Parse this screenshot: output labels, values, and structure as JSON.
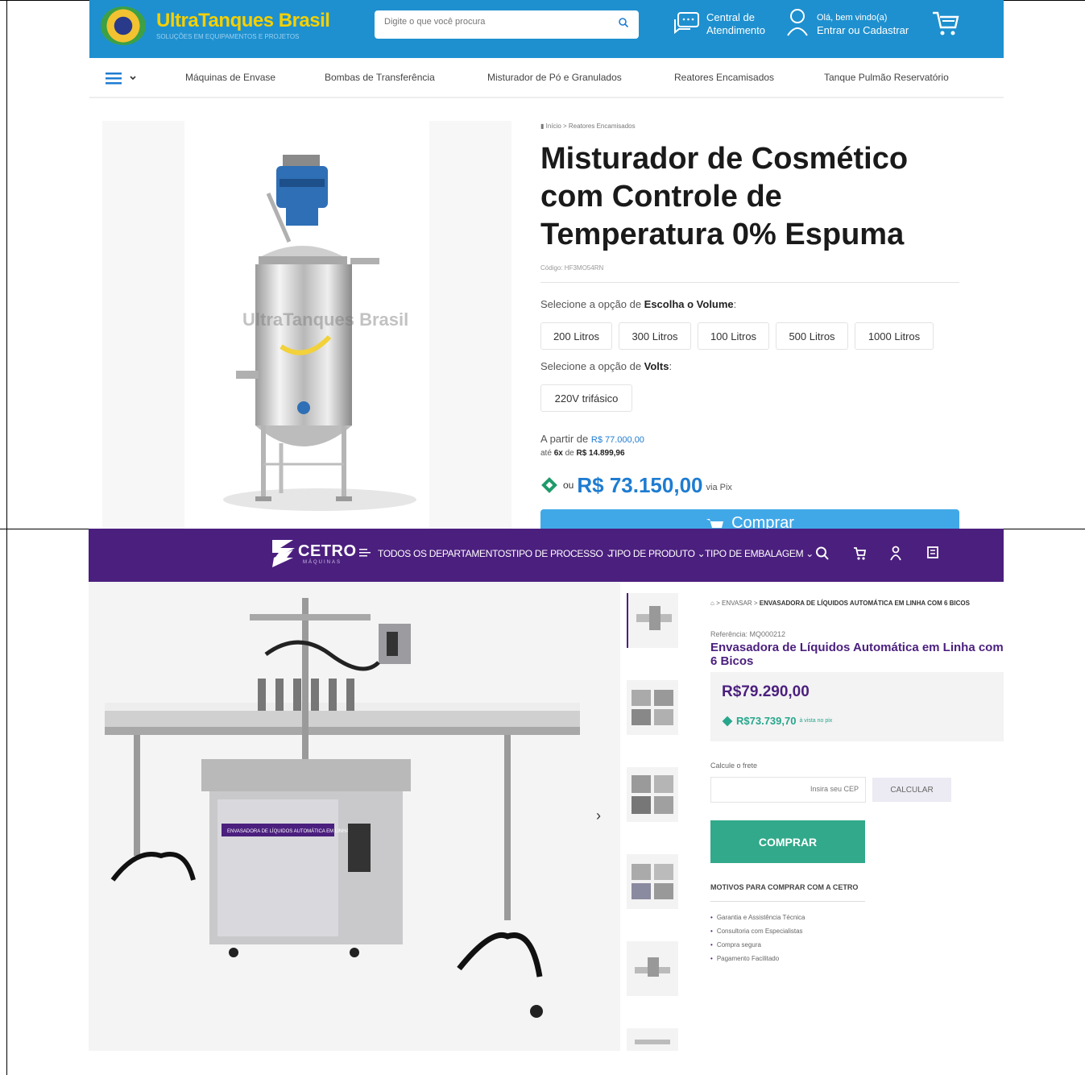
{
  "panel1": {
    "logo": {
      "name": "UltraTanques Brasil",
      "tagline": "SOLUÇÕES EM EQUIPAMENTOS E PROJETOS"
    },
    "search": {
      "placeholder": "Digite o que você procura"
    },
    "support": {
      "line1": "Central de",
      "line2": "Atendimento"
    },
    "account": {
      "line1": "Olá, bem vindo(a)",
      "line2": "Entrar ou Cadastrar"
    },
    "nav": [
      "Máquinas de Envase",
      "Bombas de Transferência",
      "Misturador de Pó e Granulados",
      "Reatores Encamisados",
      "Tanque Pulmão Reservatório"
    ],
    "breadcrumb": {
      "home": "Início",
      "sep": ">",
      "current": "Reatores Encamisados"
    },
    "watermark": "UltraTanques Brasil",
    "product": {
      "title": "Misturador de Cosmético com Controle de Temperatura 0% Espuma",
      "code": "Código: HF3MO54RN",
      "volume_prefix": "Selecione a opção de ",
      "volume_label": "Escolha o Volume",
      "volume_suffix": ":",
      "volumes": [
        "200 Litros",
        "300 Litros",
        "100 Litros",
        "500 Litros",
        "1000 Litros"
      ],
      "volts_prefix": "Selecione a opção de ",
      "volts_label": "Volts",
      "volts_suffix": ":",
      "volts": [
        "220V trifásico"
      ],
      "from_prefix": "A partir de ",
      "from_price": "R$ 77.000,00",
      "inst_prefix": "até ",
      "inst_count": "6x",
      "inst_mid": " de ",
      "inst_value": "R$ 14.899,96",
      "pix_or": "ou",
      "pix_price": "R$ 73.150,00",
      "pix_via": "via Pix",
      "buy_label": "Comprar"
    },
    "colors": {
      "header": "#1e90cf",
      "accent": "#1e7cd1",
      "pix": "#1e9b6b"
    }
  },
  "panel2": {
    "logo": {
      "name": "CETRO",
      "tagline": "MÁQUINAS"
    },
    "nav": {
      "all": "TODOS OS DEPARTAMENTOS",
      "processo": "TIPO DE PROCESSO",
      "produto": "TIPO DE PRODUTO",
      "embalagem": "TIPO DE EMBALAGEM"
    },
    "breadcrumb": {
      "sep": ">",
      "section": "ENVASAR",
      "current": "ENVASADORA DE LÍQUIDOS AUTOMÁTICA EM LINHA COM 6 BICOS"
    },
    "product": {
      "ref": "Referência: MQ000212",
      "title": "Envasadora de Líquidos Automática em Linha com 6 Bicos",
      "price": "R$79.290,00",
      "pix_price": "R$73.739,70",
      "pix_note": "à vista no pix"
    },
    "frete": {
      "label": "Calcule o frete",
      "placeholder": "Insira seu CEP",
      "button": "CALCULAR"
    },
    "buy_label": "COMPRAR",
    "reasons_title": "MOTIVOS PARA COMPRAR COM A CETRO",
    "reasons": [
      "Garantia e Assistência Técnica",
      "Consultoria com Especialistas",
      "Compra segura",
      "Pagamento Facilitado"
    ],
    "machine_label": "ENVASADORA DE LÍQUIDOS AUTOMÁTICA EM LINHA",
    "colors": {
      "header": "#4b1f7e",
      "buy": "#31a98a"
    }
  }
}
